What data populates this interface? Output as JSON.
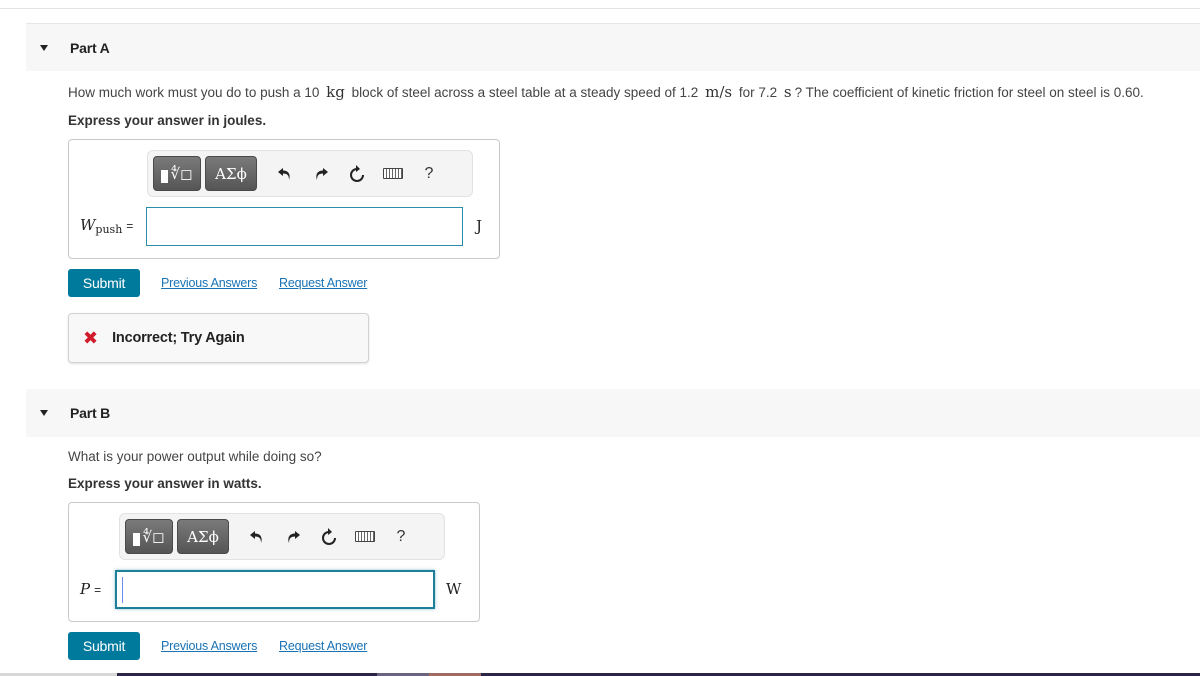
{
  "parts": {
    "a": {
      "title": "Part A",
      "question": {
        "t1": "How much work must you do to push a 10",
        "u1": "kg",
        "t2": "block of steel across a steel table at a steady speed of 1.2",
        "u2": "m/s",
        "t3": "for 7.2",
        "u3": "s",
        "t4": "? The coefficient of kinetic friction for steel on steel is 0.60."
      },
      "instruction": "Express your answer in joules.",
      "variable": "W",
      "variable_sub": "push",
      "equals": "=",
      "input_value": "",
      "unit": "J",
      "submit_label": "Submit",
      "previous_answers_label": "Previous Answers",
      "request_answer_label": "Request Answer",
      "feedback": {
        "icon": "x-icon",
        "text": "Incorrect; Try Again",
        "color": "#d11a2a"
      }
    },
    "b": {
      "title": "Part B",
      "question": "What is your power output while doing so?",
      "instruction": "Express your answer in watts.",
      "variable": "P",
      "equals": "=",
      "input_value": "",
      "unit": "W",
      "submit_label": "Submit",
      "previous_answers_label": "Previous Answers",
      "request_answer_label": "Request Answer"
    }
  },
  "toolbar": {
    "templates_icon": "templates-root-icon",
    "greek_label": "ΑΣϕ",
    "undo_icon": "undo-icon",
    "redo_icon": "redo-icon",
    "reset_icon": "reset-icon",
    "keyboard_icon": "keyboard-icon",
    "help_label": "?"
  },
  "colors": {
    "accent": "#007a9c",
    "link": "#1a73b5",
    "input_border": "#2a8eaa",
    "error": "#d11a2a",
    "header_bg": "#f7f7f7"
  }
}
